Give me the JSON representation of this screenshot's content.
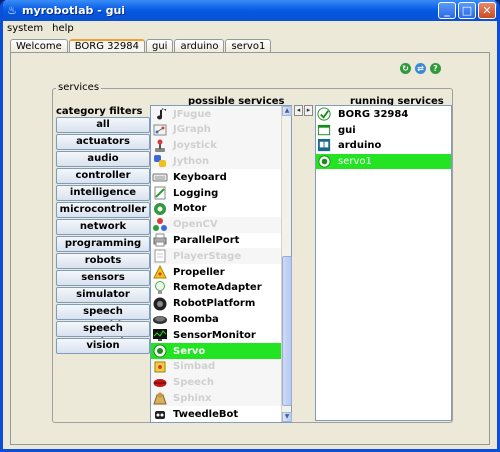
{
  "window": {
    "title": "myrobotlab - gui",
    "controls": [
      "_",
      "□",
      "✕"
    ]
  },
  "menu": [
    "system",
    "help"
  ],
  "tabs": [
    "Welcome",
    "BORG 32984",
    "gui",
    "arduino",
    "servo1"
  ],
  "services_group_label": "services",
  "category_filters": {
    "label": "category filters",
    "items": [
      "all",
      "actuators",
      "audio",
      "controller",
      "intelligence",
      "microcontroller",
      "network",
      "programming",
      "robots",
      "sensors",
      "simulator",
      "speech recognition",
      "speech synthesis",
      "vision"
    ]
  },
  "possible_services": {
    "header": "possible services",
    "items": [
      {
        "name": "JFugue",
        "state": "disabled",
        "icon": "music-note-icon"
      },
      {
        "name": "JGraph",
        "state": "disabled",
        "icon": "graph-icon"
      },
      {
        "name": "Joystick",
        "state": "disabled",
        "icon": "joystick-icon"
      },
      {
        "name": "Jython",
        "state": "disabled",
        "icon": "python-icon"
      },
      {
        "name": "Keyboard",
        "state": "enabled",
        "icon": "keyboard-icon"
      },
      {
        "name": "Logging",
        "state": "enabled",
        "icon": "logging-icon"
      },
      {
        "name": "Motor",
        "state": "enabled",
        "icon": "motor-icon"
      },
      {
        "name": "OpenCV",
        "state": "disabled",
        "icon": "opencv-icon"
      },
      {
        "name": "ParallelPort",
        "state": "enabled",
        "icon": "printer-icon"
      },
      {
        "name": "PlayerStage",
        "state": "disabled",
        "icon": "document-icon"
      },
      {
        "name": "Propeller",
        "state": "enabled",
        "icon": "propeller-icon"
      },
      {
        "name": "RemoteAdapter",
        "state": "enabled",
        "icon": "lightbulb-icon"
      },
      {
        "name": "RobotPlatform",
        "state": "enabled",
        "icon": "wheel-icon"
      },
      {
        "name": "Roomba",
        "state": "enabled",
        "icon": "roomba-icon"
      },
      {
        "name": "SensorMonitor",
        "state": "enabled",
        "icon": "monitor-icon"
      },
      {
        "name": "Servo",
        "state": "selected",
        "icon": "servo-icon"
      },
      {
        "name": "Simbad",
        "state": "disabled",
        "icon": "simbad-icon"
      },
      {
        "name": "Speech",
        "state": "disabled",
        "icon": "lips-icon"
      },
      {
        "name": "Sphinx",
        "state": "disabled",
        "icon": "sphinx-icon"
      },
      {
        "name": "TweedleBot",
        "state": "enabled",
        "icon": "tweedlebot-icon"
      }
    ]
  },
  "running_services": {
    "header": "running services",
    "items": [
      {
        "name": "BORG 32984",
        "selected": false,
        "icon": "runtime-icon"
      },
      {
        "name": "gui",
        "selected": false,
        "icon": "gui-icon"
      },
      {
        "name": "arduino",
        "selected": false,
        "icon": "arduino-icon"
      },
      {
        "name": "servo1",
        "selected": true,
        "icon": "servo-icon"
      }
    ]
  },
  "move_buttons": [
    "◂",
    "▸"
  ],
  "scroll_arrows": [
    "▲",
    "▼"
  ],
  "toolbar_icons": [
    "refresh-icon",
    "swap-icon",
    "help-icon"
  ],
  "colors": {
    "selected_row": "#22e422",
    "title_bar": "#0a5ee6"
  }
}
